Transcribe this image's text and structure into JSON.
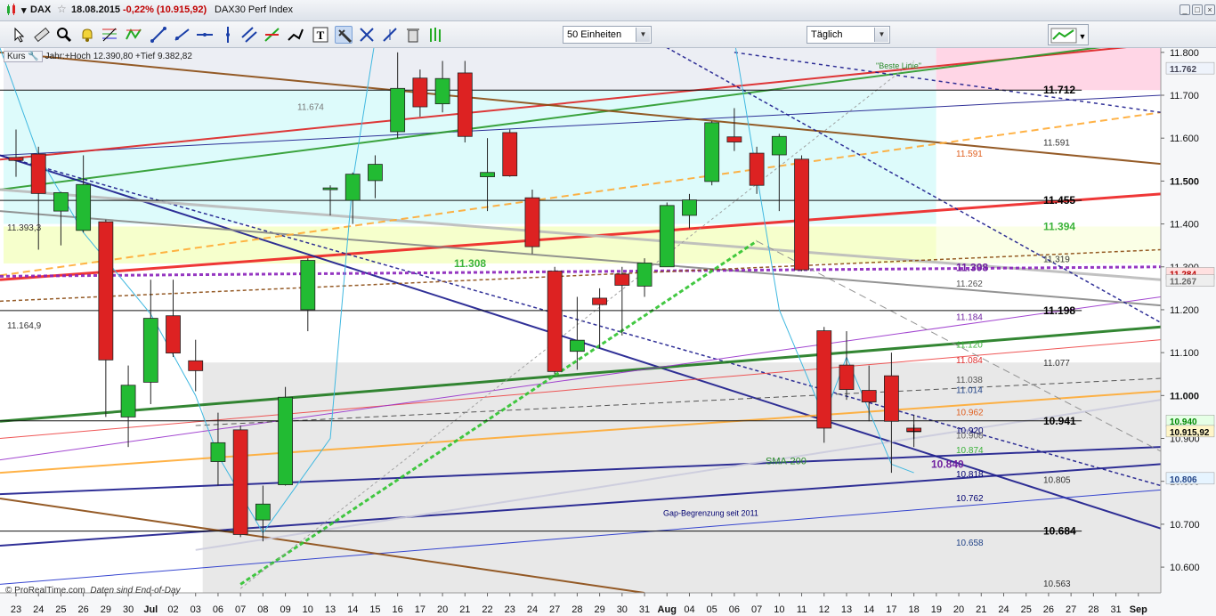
{
  "titlebar": {
    "symbol": "DAX",
    "date": "18.08.2015",
    "change": "-0,22% (10.915,92)",
    "name": "DAX30 Perf Index",
    "win_buttons": [
      "_",
      "□",
      "×"
    ]
  },
  "toolbar": {
    "units_select": "50 Einheiten",
    "period_select": "Täglich",
    "tools": [
      "cursor-icon",
      "ruler-icon",
      "zoom-icon",
      "alert-bell-icon",
      "fibonacci-icon",
      "zigzag-icon",
      "trendline-icon",
      "ray-icon",
      "horizontal-line-icon",
      "vertical-line-icon",
      "channel-icon",
      "arrows-icon",
      "pitchfork-icon",
      "text-icon",
      "hammer-icon",
      "cross-arrows-icon",
      "delete-icon",
      "trash-icon",
      "bars-icon"
    ],
    "active_tool": "hammer-icon"
  },
  "legend": {
    "kurs_label": "Kurs",
    "jahr_text": "Jahr:+Hoch 12.390,80 +Tief 9.382,82"
  },
  "footer": {
    "brand": "© ProRealTime.com",
    "note": "Daten sind End-of-Day"
  },
  "colors": {
    "bull": "#22bb33",
    "bear": "#dd2222",
    "pink_zone": "#ffd6e6",
    "cyan_zone": "#ddfbfb",
    "yellow_zone": "#f6ffcc",
    "grey_zone": "#e8e8e8"
  },
  "chart_data": {
    "type": "candlestick",
    "instrument": "DAX",
    "y_axis_ticks": [
      "11.800",
      "11.700",
      "11.600",
      "11.500",
      "11.400",
      "11.300",
      "11.200",
      "11.100",
      "11.000",
      "10.900",
      "10.800",
      "10.700",
      "10.600"
    ],
    "y_axis_markers": [
      {
        "text": "11.762",
        "value": 11762,
        "bg": "#eef3fb",
        "color": "#445"
      },
      {
        "text": "11.284",
        "value": 11284,
        "bg": "#ffe0e0",
        "color": "#b00"
      },
      {
        "text": "11.267",
        "value": 11267,
        "bg": "#eeeeee",
        "color": "#666"
      },
      {
        "text": "10.940",
        "value": 10940,
        "bg": "#e6ffe6",
        "color": "#080"
      },
      {
        "text": "10.915,92",
        "value": 10915.92,
        "bg": "#fff6c8",
        "color": "#000"
      },
      {
        "text": "10.806",
        "value": 10806,
        "bg": "#e6f4ff",
        "color": "#248"
      }
    ],
    "x_axis_labels": [
      "23",
      "24",
      "25",
      "26",
      "29",
      "30",
      "Jul",
      "02",
      "03",
      "06",
      "07",
      "08",
      "09",
      "10",
      "13",
      "14",
      "15",
      "16",
      "17",
      "20",
      "21",
      "22",
      "23",
      "24",
      "27",
      "28",
      "29",
      "30",
      "31",
      "Aug",
      "04",
      "05",
      "06",
      "07",
      "10",
      "11",
      "12",
      "13",
      "14",
      "17",
      "18",
      "19",
      "20",
      "21",
      "24",
      "25",
      "26",
      "27",
      "28",
      "31",
      "Sep"
    ],
    "ylim": [
      10540,
      11810
    ],
    "candles": [
      {
        "d": "23",
        "o": 11555,
        "h": 11620,
        "l": 11510,
        "c": 11548
      },
      {
        "d": "24",
        "o": 11563,
        "h": 11580,
        "l": 11340,
        "c": 11471
      },
      {
        "d": "25",
        "o": 11430,
        "h": 11475,
        "l": 11350,
        "c": 11473
      },
      {
        "d": "26",
        "o": 11385,
        "h": 11560,
        "l": 11380,
        "c": 11492
      },
      {
        "d": "29",
        "o": 11405,
        "h": 11410,
        "l": 10950,
        "c": 11083
      },
      {
        "d": "30",
        "o": 10950,
        "h": 11070,
        "l": 10880,
        "c": 11024
      },
      {
        "d": "Jul",
        "o": 11031,
        "h": 11270,
        "l": 10980,
        "c": 11180
      },
      {
        "d": "02",
        "o": 11186,
        "h": 11270,
        "l": 11090,
        "c": 11099
      },
      {
        "d": "03",
        "o": 11081,
        "h": 11130,
        "l": 11010,
        "c": 11058
      },
      {
        "d": "06",
        "o": 10846,
        "h": 10960,
        "l": 10790,
        "c": 10890
      },
      {
        "d": "07",
        "o": 10920,
        "h": 10930,
        "l": 10670,
        "c": 10676
      },
      {
        "d": "08",
        "o": 10710,
        "h": 10790,
        "l": 10660,
        "c": 10747
      },
      {
        "d": "09",
        "o": 10792,
        "h": 11020,
        "l": 10790,
        "c": 10996
      },
      {
        "d": "10",
        "o": 11200,
        "h": 11320,
        "l": 11150,
        "c": 11315
      },
      {
        "d": "13",
        "o": 11480,
        "h": 11490,
        "l": 11420,
        "c": 11484
      },
      {
        "d": "14",
        "o": 11455,
        "h": 11520,
        "l": 11400,
        "c": 11516
      },
      {
        "d": "15",
        "o": 11501,
        "h": 11560,
        "l": 11460,
        "c": 11539
      },
      {
        "d": "16",
        "o": 11615,
        "h": 11800,
        "l": 11600,
        "c": 11716
      },
      {
        "d": "17",
        "o": 11740,
        "h": 11760,
        "l": 11650,
        "c": 11673
      },
      {
        "d": "20",
        "o": 11680,
        "h": 11780,
        "l": 11660,
        "c": 11739
      },
      {
        "d": "21",
        "o": 11752,
        "h": 11780,
        "l": 11590,
        "c": 11604
      },
      {
        "d": "22",
        "o": 11510,
        "h": 11600,
        "l": 11430,
        "c": 11520
      },
      {
        "d": "23",
        "o": 11613,
        "h": 11620,
        "l": 11510,
        "c": 11512
      },
      {
        "d": "24",
        "o": 11461,
        "h": 11480,
        "l": 11330,
        "c": 11347
      },
      {
        "d": "27",
        "o": 11290,
        "h": 11300,
        "l": 11050,
        "c": 11056
      },
      {
        "d": "28",
        "o": 11103,
        "h": 11230,
        "l": 11060,
        "c": 11129
      },
      {
        "d": "29",
        "o": 11227,
        "h": 11250,
        "l": 11110,
        "c": 11212
      },
      {
        "d": "30",
        "o": 11283,
        "h": 11300,
        "l": 11140,
        "c": 11257
      },
      {
        "d": "31",
        "o": 11255,
        "h": 11320,
        "l": 11230,
        "c": 11309
      },
      {
        "d": "Aug",
        "o": 11300,
        "h": 11450,
        "l": 11300,
        "c": 11443
      },
      {
        "d": "04",
        "o": 11420,
        "h": 11470,
        "l": 11390,
        "c": 11456
      },
      {
        "d": "05",
        "o": 11499,
        "h": 11640,
        "l": 11490,
        "c": 11636
      },
      {
        "d": "06",
        "o": 11603,
        "h": 11670,
        "l": 11570,
        "c": 11591
      },
      {
        "d": "07",
        "o": 11565,
        "h": 11580,
        "l": 11470,
        "c": 11490
      },
      {
        "d": "10",
        "o": 11561,
        "h": 11610,
        "l": 11430,
        "c": 11604
      },
      {
        "d": "11",
        "o": 11551,
        "h": 11560,
        "l": 11290,
        "c": 11293
      },
      {
        "d": "12",
        "o": 11151,
        "h": 11160,
        "l": 10890,
        "c": 10924
      },
      {
        "d": "13",
        "o": 11071,
        "h": 11150,
        "l": 10990,
        "c": 11014
      },
      {
        "d": "14",
        "o": 11012,
        "h": 11070,
        "l": 10940,
        "c": 10985
      },
      {
        "d": "17",
        "o": 11046,
        "h": 11100,
        "l": 10820,
        "c": 10940
      },
      {
        "d": "18",
        "o": 10924,
        "h": 10955,
        "l": 10880,
        "c": 10916
      }
    ],
    "level_labels": [
      {
        "text": "11.712",
        "value": 11712,
        "color": "#000",
        "bold": true
      },
      {
        "text": "11.674",
        "value": 11674,
        "color": "#777",
        "bold": false,
        "side": "left"
      },
      {
        "text": "11.591",
        "value": 11591,
        "color": "#333",
        "bold": false
      },
      {
        "text": "11.591",
        "value": 11565,
        "color": "#e06020",
        "bold": false,
        "side": "mid"
      },
      {
        "text": "11.455",
        "value": 11455,
        "color": "#000",
        "bold": true
      },
      {
        "text": "11.394",
        "value": 11394,
        "color": "#3cb33c",
        "bold": true
      },
      {
        "text": "11.393,3",
        "value": 11393,
        "color": "#333",
        "bold": false,
        "side": "far-left"
      },
      {
        "text": "11.319",
        "value": 11319,
        "color": "#333",
        "bold": false
      },
      {
        "text": "11.308",
        "value": 11308,
        "color": "#3cb33c",
        "bold": true,
        "side": "left-mid"
      },
      {
        "text": "11.308",
        "value": 11298,
        "color": "#7020a0",
        "bold": true,
        "side": "mid"
      },
      {
        "text": "11.262",
        "value": 11262,
        "color": "#555",
        "bold": false,
        "side": "mid"
      },
      {
        "text": "11.198",
        "value": 11198,
        "color": "#000",
        "bold": true
      },
      {
        "text": "11.184",
        "value": 11184,
        "color": "#7020a0",
        "bold": false,
        "side": "mid"
      },
      {
        "text": "11.164,9",
        "value": 11165,
        "color": "#333",
        "bold": false,
        "side": "far-left"
      },
      {
        "text": "11.120",
        "value": 11120,
        "color": "#3cb33c",
        "bold": false,
        "side": "mid"
      },
      {
        "text": "11.084",
        "value": 11084,
        "color": "#e03030",
        "bold": false,
        "side": "mid"
      },
      {
        "text": "11.077",
        "value": 11077,
        "color": "#333",
        "bold": false
      },
      {
        "text": "11.038",
        "value": 11038,
        "color": "#555",
        "bold": false,
        "side": "mid"
      },
      {
        "text": "11.014",
        "value": 11014,
        "color": "#248",
        "bold": false,
        "side": "mid"
      },
      {
        "text": "10.962",
        "value": 10962,
        "color": "#e06020",
        "bold": false,
        "side": "mid"
      },
      {
        "text": "10.941",
        "value": 10941,
        "color": "#000",
        "bold": true
      },
      {
        "text": "10.920",
        "value": 10920,
        "color": "#000070",
        "bold": false,
        "side": "mid"
      },
      {
        "text": "10.908",
        "value": 10908,
        "color": "#666",
        "bold": false,
        "side": "mid"
      },
      {
        "text": "10.874",
        "value": 10874,
        "color": "#3cb33c",
        "bold": false,
        "side": "mid"
      },
      {
        "text": "10.840",
        "value": 10840,
        "color": "#7020a0",
        "bold": true,
        "side": "mid-left"
      },
      {
        "text": "10.818",
        "value": 10818,
        "color": "#000070",
        "bold": false,
        "side": "mid"
      },
      {
        "text": "10.805",
        "value": 10805,
        "color": "#333",
        "bold": false
      },
      {
        "text": "10.762",
        "value": 10762,
        "color": "#000070",
        "bold": false,
        "side": "mid"
      },
      {
        "text": "10.684",
        "value": 10684,
        "color": "#000",
        "bold": true
      },
      {
        "text": "10.658",
        "value": 10658,
        "color": "#248",
        "bold": false,
        "side": "mid"
      },
      {
        "text": "10.563",
        "value": 10563,
        "color": "#333",
        "bold": false
      }
    ],
    "annotations": [
      {
        "text": "\"Beste Linie\"",
        "color": "#2a8a2a"
      },
      {
        "text": "SMA-200",
        "color": "#2a8a2a"
      },
      {
        "text": "Gap-Begrenzung seit 2011",
        "color": "#000070"
      }
    ]
  }
}
